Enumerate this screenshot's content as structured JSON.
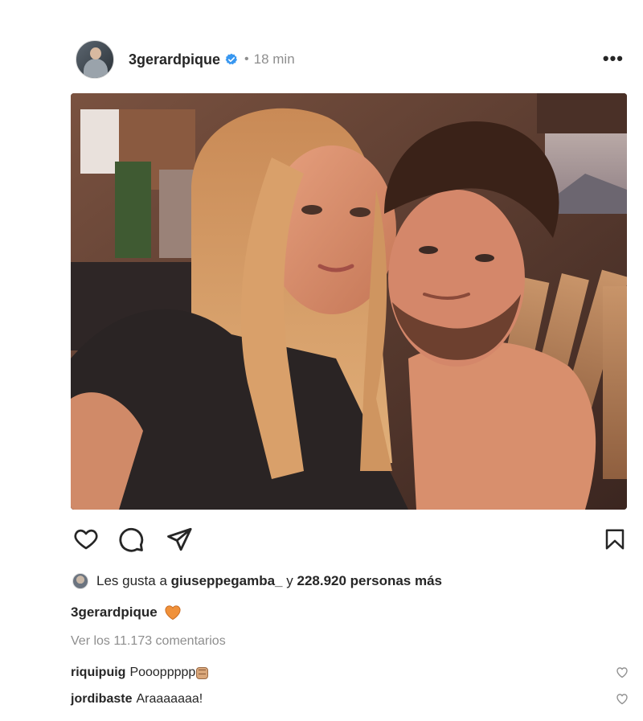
{
  "post": {
    "username": "3gerardpique",
    "separator": "•",
    "time": "18 min",
    "more_label": "•••"
  },
  "icons": {
    "like": "heart-icon",
    "comment": "comment-icon",
    "share": "paper-plane-icon",
    "save": "bookmark-icon",
    "verified": "verified-badge-icon"
  },
  "likes": {
    "prefix": "Les gusta a",
    "user": "giuseppegamba_",
    "conjunction": "y",
    "count_text": "228.920 personas más"
  },
  "caption": {
    "user": "3gerardpique"
  },
  "view_comments": "Ver los 11.173 comentarios",
  "comments": [
    {
      "user": "riquipuig",
      "text": "Poooppppp"
    },
    {
      "user": "jordibaste",
      "text": "Araaaaaaa!"
    }
  ],
  "colors": {
    "text": "#262626",
    "muted": "#8e8e8e",
    "verified": "#3897f0",
    "heart_emoji": "#f0913a"
  }
}
